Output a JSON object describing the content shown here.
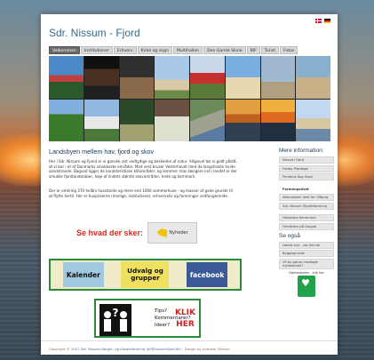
{
  "site": {
    "title": "Sdr. Nissum - Fjord",
    "flags": [
      "danish-flag-icon",
      "german-flag-icon"
    ]
  },
  "nav": {
    "items": [
      {
        "label": "Velkommen",
        "active": true
      },
      {
        "label": "Institutioner"
      },
      {
        "label": "Erhverv"
      },
      {
        "label": "Kirke og sogn"
      },
      {
        "label": "Multihallen"
      },
      {
        "label": "Den Gamle Skole"
      },
      {
        "label": "BIF"
      },
      {
        "label": "Turist"
      },
      {
        "label": "Fotos"
      }
    ]
  },
  "main": {
    "heading": "Landsbyen mellem hav, fjord og skov",
    "paragraph1": "Her i Sdr. Nissum og Fjand er vi ganske vist vedtydige og beskedne af natur. Alligevel tør vi godt påstå, at vi bor i et af Danmarks smukkeste områder. Mod vest bruser Vesterhavet med de langstrakte hvide sandstrande. Bagved ligger de karakteristiske klitområder, og kommer man længere ind i landet er der smukke fjordlandskaber, høje af lindets største skovområder, hede og kornmark.",
    "paragraph2": "Der er omkring 270 helårs husstande og mere end 1000 sommerhuse - og masser af gode grunde til at flytte hertil. Her er huspriserne rimelige, institutioner, erhvervsliv og foreninger vedfungerende.",
    "news_text": "Se hvad der sker:",
    "news_button": "Nyheder",
    "kalender": "Kalender",
    "udvalg": "Udvalg og",
    "grupper": "grupper",
    "facebook": "facebook",
    "tips_line1": "Tips?",
    "tips_line2": "Kommentarer?",
    "tips_line3": "Ideer?",
    "klik": "KLIK",
    "her": "HER"
  },
  "sidebar": {
    "heading": "Mere information:",
    "links1": [
      "Nissum Fjord",
      "Husby Plantage",
      "Feriehus Kog Havn"
    ],
    "foreningsliv": "Foreningslivet",
    "links2": [
      "Aftenskolen Vest for Ulfborg",
      "Sdr. Nissum Skytteforening"
    ],
    "links3": [
      "Holstebro Kommune",
      "Områdeni på Google"
    ],
    "se_ogsa": "Se også",
    "links4": [
      "Lokalt vejr - via dmi.dk",
      "Byggegrunde",
      "Vil du gerne modtage nyhedsmail?"
    ],
    "hjerte": "Hjertestarter - klik her"
  },
  "footer": {
    "prefix": "Copyright © 2007",
    "link": "Sdr. Nissum Borger- og Ildsaleforening (bif@nissumfjord.dk)",
    "suffix": "· Design by Andreas Vikland"
  },
  "colors": {
    "accent": "#3a6a8c",
    "news_red": "#e0241a",
    "frame_green": "#2a8a3a",
    "facebook": "#3b5998"
  }
}
